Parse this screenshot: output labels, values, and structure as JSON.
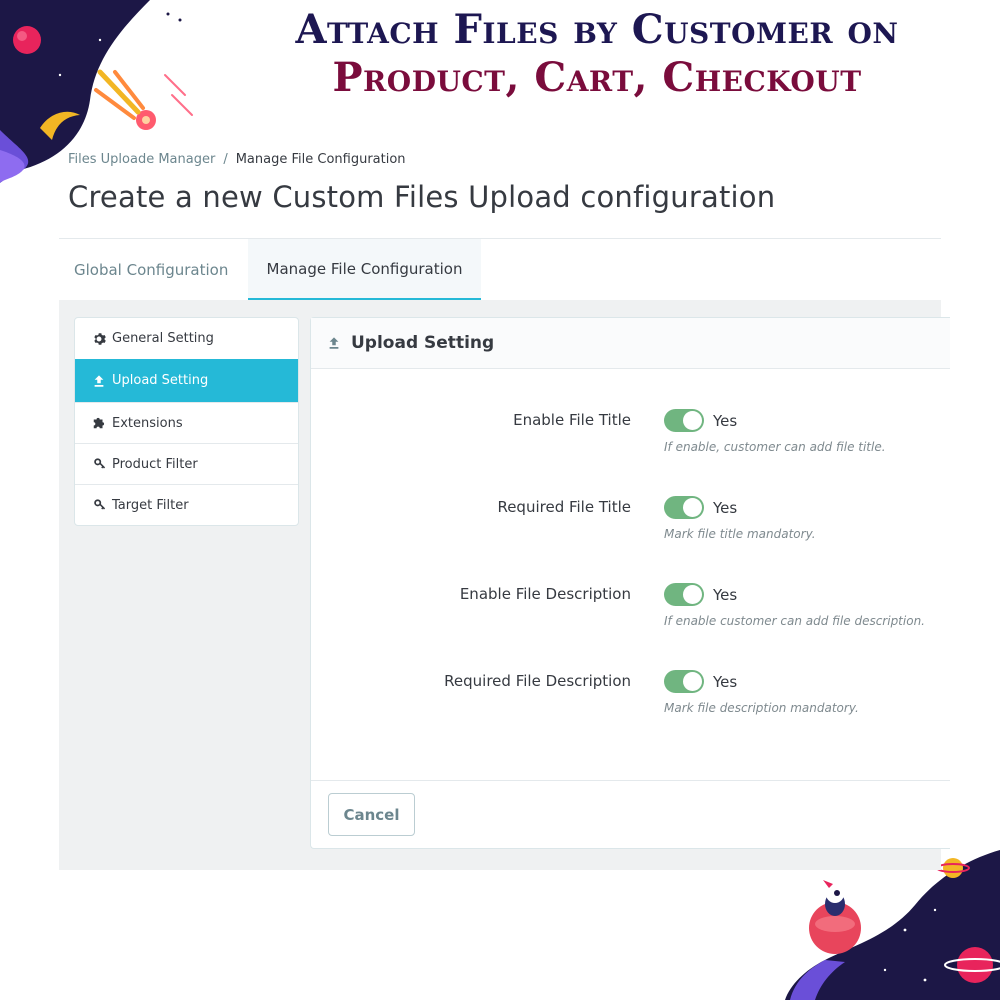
{
  "promo": {
    "line1": "Attach Files by Customer on",
    "line2": "Product, Cart, Checkout"
  },
  "breadcrumb": {
    "parent": "Files Uploade Manager",
    "separator": "/",
    "current": "Manage File Configuration"
  },
  "page_title": "Create a new Custom Files Upload configuration",
  "tabs": [
    {
      "label": "Global Configuration",
      "active": false
    },
    {
      "label": "Manage File Configuration",
      "active": true
    }
  ],
  "sidebar": {
    "items": [
      {
        "label": "General Setting",
        "icon": "gear-icon",
        "active": false
      },
      {
        "label": "Upload Setting",
        "icon": "upload-icon",
        "active": true
      },
      {
        "label": "Extensions",
        "icon": "puzzle-icon",
        "active": false
      },
      {
        "label": "Product Filter",
        "icon": "key-icon",
        "active": false
      },
      {
        "label": "Target Filter",
        "icon": "key-icon",
        "active": false
      }
    ]
  },
  "panel": {
    "title": "Upload Setting",
    "title_icon": "upload-icon",
    "fields": [
      {
        "label": "Enable File Title",
        "value": "Yes",
        "enabled": true,
        "help": "If enable, customer can add file title."
      },
      {
        "label": "Required File Title",
        "value": "Yes",
        "enabled": true,
        "help": "Mark file title mandatory."
      },
      {
        "label": "Enable File Description",
        "value": "Yes",
        "enabled": true,
        "help": "If enable customer can add file description."
      },
      {
        "label": "Required File Description",
        "value": "Yes",
        "enabled": true,
        "help": "Mark file description mandatory."
      }
    ],
    "cancel_label": "Cancel"
  },
  "colors": {
    "accent": "#25b9d7",
    "switch_on": "#70b580",
    "promo_navy": "#1d1752",
    "promo_maroon": "#7a0c3c"
  }
}
